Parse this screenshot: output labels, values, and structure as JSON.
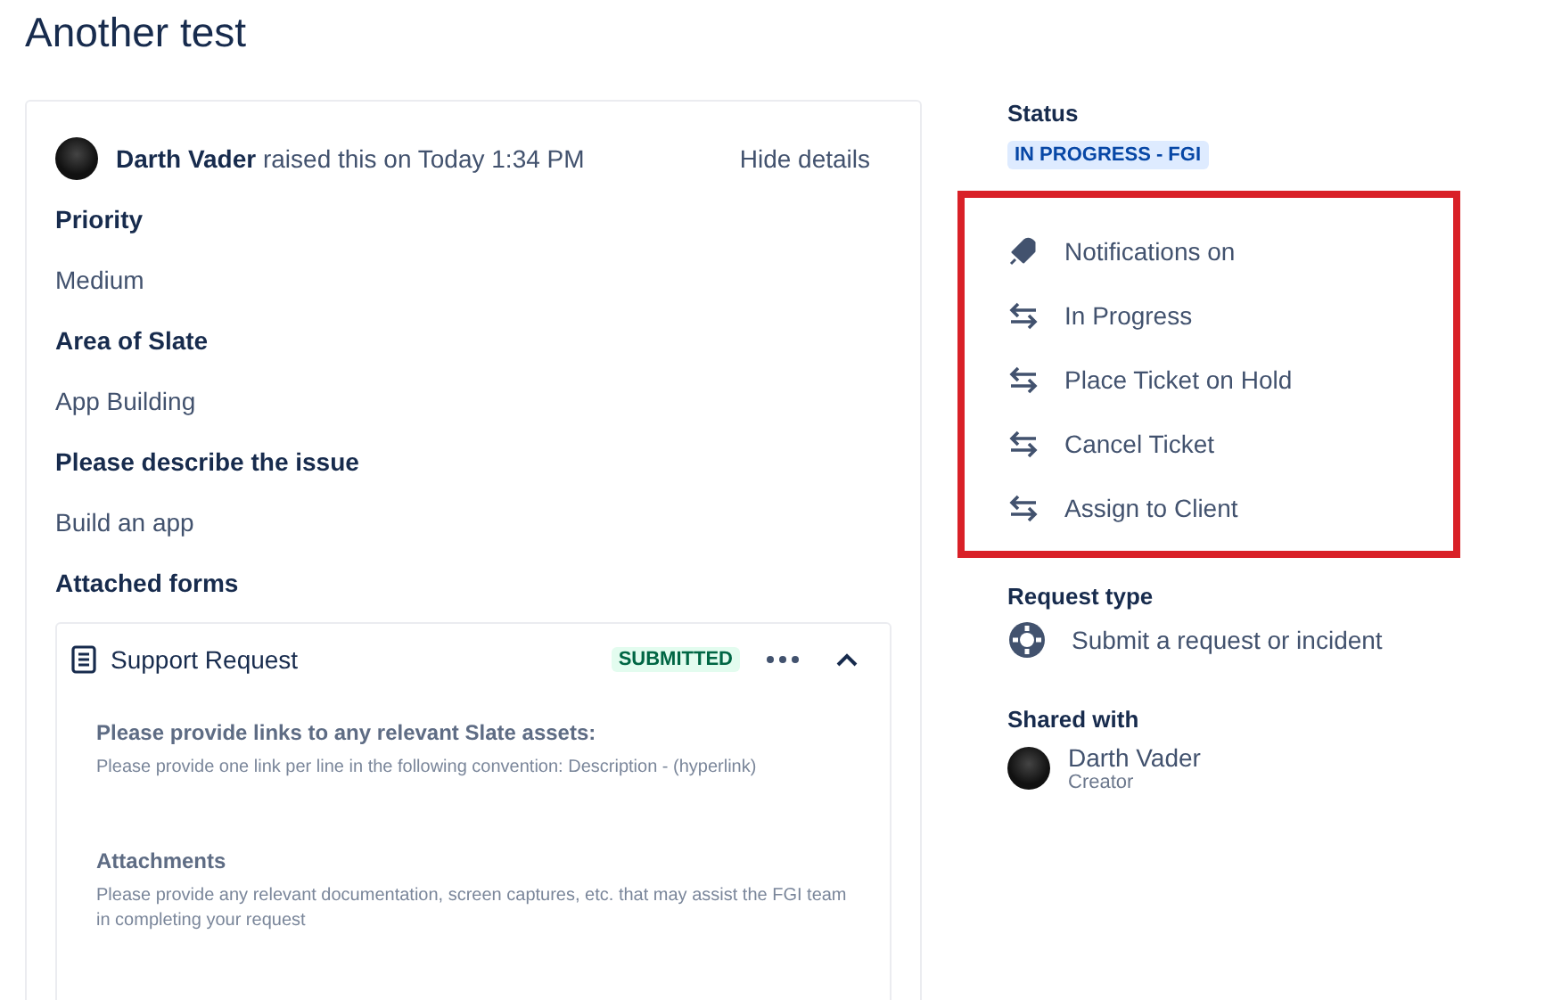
{
  "title": "Another test",
  "request": {
    "reporter": "Darth Vader",
    "raised_text": "raised this on Today 1:34 PM",
    "hide_details": "Hide details",
    "fields": [
      {
        "label": "Priority",
        "value": "Medium"
      },
      {
        "label": "Area of Slate",
        "value": "App Building"
      },
      {
        "label": "Please describe the issue",
        "value": "Build an app"
      }
    ],
    "attached_forms": {
      "heading": "Attached forms",
      "form": {
        "name": "Support Request",
        "badge": "SUBMITTED",
        "expanded": true,
        "questions": [
          {
            "label": "Please provide links to any relevant Slate assets:",
            "hint": "Please provide one link per line in the following convention: Description - (hyperlink)"
          },
          {
            "label": "Attachments",
            "hint": "Please provide any relevant documentation, screen captures, etc. that may assist the FGI team in completing your request"
          }
        ]
      }
    }
  },
  "sidebar": {
    "status": {
      "heading": "Status",
      "value": "IN PROGRESS - FGI"
    },
    "actions": [
      {
        "kind": "notification",
        "label": "Notifications on"
      },
      {
        "kind": "transition",
        "label": "In Progress"
      },
      {
        "kind": "transition",
        "label": "Place Ticket on Hold"
      },
      {
        "kind": "transition",
        "label": "Cancel Ticket"
      },
      {
        "kind": "transition",
        "label": "Assign to Client"
      }
    ],
    "request_type": {
      "heading": "Request type",
      "value": "Submit a request or incident"
    },
    "shared_with": {
      "heading": "Shared with",
      "people": [
        {
          "name": "Darth Vader",
          "role": "Creator"
        }
      ]
    }
  }
}
